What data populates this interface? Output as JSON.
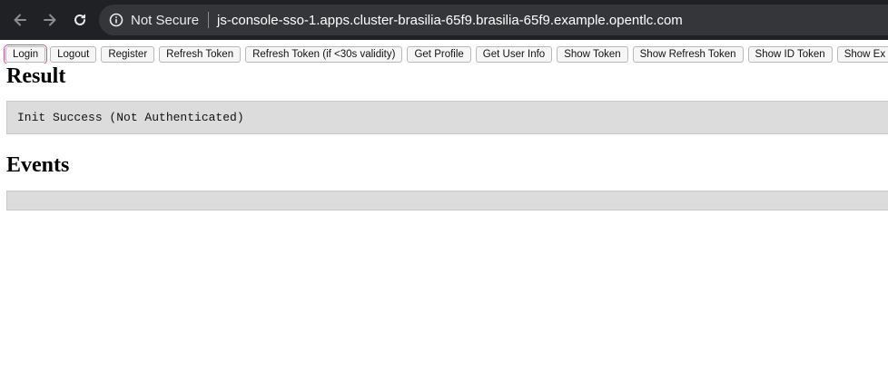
{
  "browser": {
    "security_label": "Not Secure",
    "url": "js-console-sso-1.apps.cluster-brasilia-65f9.brasilia-65f9.example.opentlc.com",
    "icons": [
      "back-arrow-icon",
      "forward-arrow-icon",
      "reload-icon",
      "info-icon"
    ]
  },
  "toolbar": {
    "buttons": [
      {
        "label": "Login",
        "focused": true
      },
      {
        "label": "Logout"
      },
      {
        "label": "Register"
      },
      {
        "label": "Refresh Token"
      },
      {
        "label": "Refresh Token (if <30s validity)"
      },
      {
        "label": "Get Profile"
      },
      {
        "label": "Get User Info"
      },
      {
        "label": "Show Token"
      },
      {
        "label": "Show Refresh Token"
      },
      {
        "label": "Show ID Token"
      },
      {
        "label": "Show Ex"
      }
    ]
  },
  "result": {
    "heading": "Result",
    "text": "Init Success (Not Authenticated)"
  },
  "events": {
    "heading": "Events",
    "text": ""
  },
  "colors": {
    "chrome_bar": "#202124",
    "omnibox": "#35363a",
    "panel": "#dcdcdc",
    "focus_outline": "#e0459b"
  }
}
